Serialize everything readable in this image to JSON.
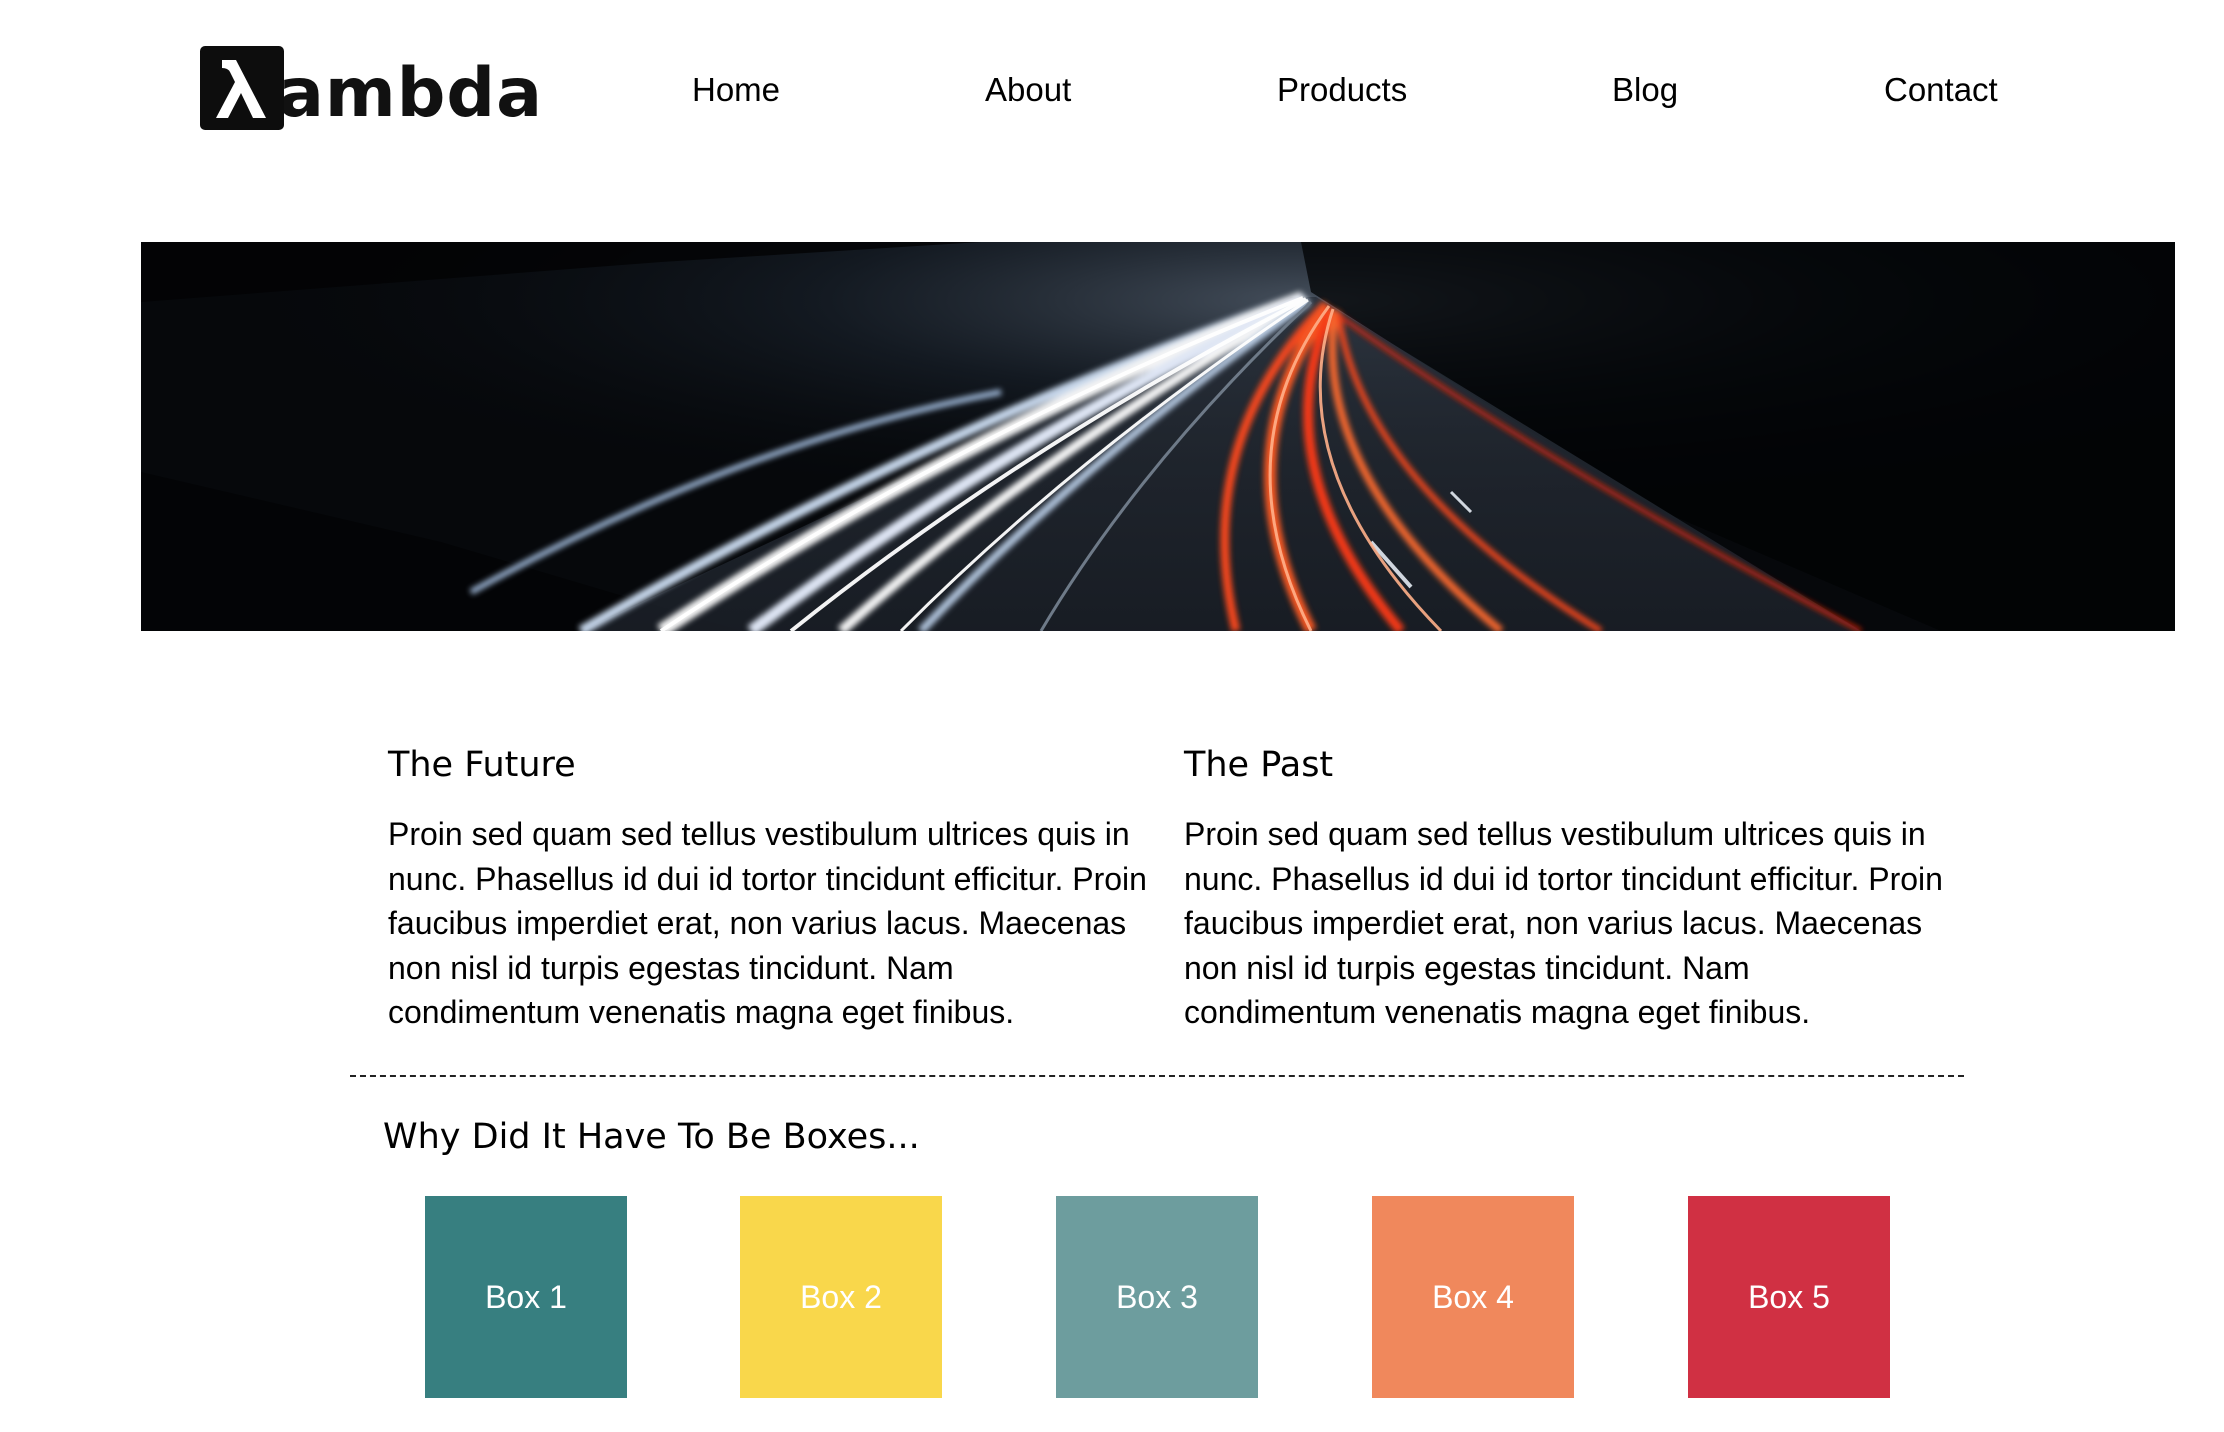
{
  "logo": {
    "mark": "λ",
    "text": "ambda"
  },
  "nav": {
    "items": [
      {
        "label": "Home"
      },
      {
        "label": "About"
      },
      {
        "label": "Products"
      },
      {
        "label": "Blog"
      },
      {
        "label": "Contact"
      }
    ]
  },
  "hero": {
    "image": "night highway light trails"
  },
  "sections": {
    "future": {
      "title": "The Future",
      "body": "Proin sed quam sed tellus vestibulum ultrices quis in nunc. Phasellus id dui id tortor tincidunt efficitur. Proin faucibus imperdiet erat, non varius lacus. Maecenas non nisl id turpis egestas tincidunt. Nam condimentum venenatis magna eget finibus."
    },
    "past": {
      "title": "The Past",
      "body": "Proin sed quam sed tellus vestibulum ultrices quis in nunc. Phasellus id dui id tortor tincidunt efficitur. Proin faucibus imperdiet erat, non varius lacus. Maecenas non nisl id turpis egestas tincidunt. Nam condimentum venenatis magna eget finibus."
    }
  },
  "boxes": {
    "title": "Why Did It Have To Be Boxes...",
    "items": [
      {
        "label": "Box 1",
        "color": "#377f80"
      },
      {
        "label": "Box 2",
        "color": "#f9d74b"
      },
      {
        "label": "Box 3",
        "color": "#6d9d9e"
      },
      {
        "label": "Box 4",
        "color": "#f0885c"
      },
      {
        "label": "Box 5",
        "color": "#d03043"
      }
    ]
  }
}
